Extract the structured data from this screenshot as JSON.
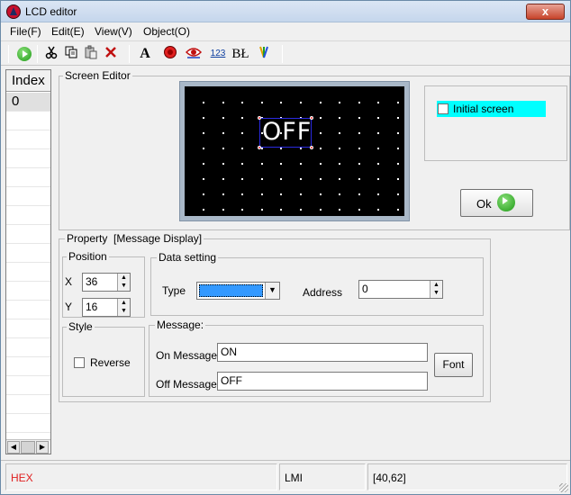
{
  "window": {
    "title": "LCD editor",
    "close_symbol": "x"
  },
  "menu": {
    "file": "File(F)",
    "edit": "Edit(E)",
    "view": "View(V)",
    "object": "Object(O)"
  },
  "toolbar": {
    "icons": [
      "go-icon",
      "cut-icon",
      "copy-icon",
      "paste-icon",
      "delete-icon",
      "text-icon",
      "record-icon",
      "view-icon",
      "number-icon",
      "bitmap-icon",
      "paint-icon"
    ],
    "text_label": "A",
    "number_label": "123",
    "bitmap_label": "BŁ"
  },
  "index_panel": {
    "header": "Index",
    "rows": [
      "0"
    ]
  },
  "screen_editor": {
    "label": "Screen Editor",
    "lcd_text": "OFF",
    "initial_screen_label": "Initial screen",
    "initial_screen_checked": false,
    "ok_label": "Ok"
  },
  "property": {
    "label": "Property",
    "type_label": "[Message Display]",
    "position": {
      "label": "Position",
      "x_label": "X",
      "x_value": "36",
      "y_label": "Y",
      "y_value": "16"
    },
    "data_setting": {
      "label": "Data setting",
      "type_field_label": "Type",
      "address_label": "Address",
      "address_value": "0"
    },
    "style": {
      "label": "Style",
      "reverse_label": "Reverse",
      "reverse_checked": false
    },
    "message": {
      "label": "Message:",
      "on_label": "On Message:",
      "on_value": "ON",
      "off_label": "Off Message:",
      "off_value": "OFF",
      "font_label": "Font"
    }
  },
  "status": {
    "mode": "HEX",
    "mode_color": "#e02020",
    "device": "LMI",
    "coords": "[40,62]"
  },
  "colors": {
    "lcd_background": "#000000",
    "highlight": "#00ffff",
    "selection": "#3399ff"
  }
}
